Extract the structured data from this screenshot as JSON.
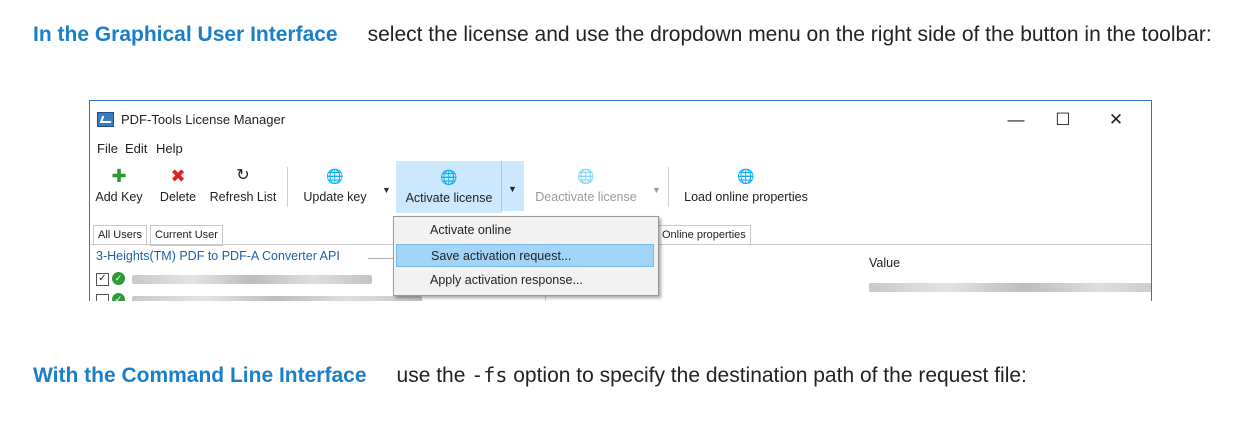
{
  "intro": {
    "keyword": "In the Graphical User Interface",
    "text": "select the license and use the dropdown menu on the right side of the button in the toolbar:"
  },
  "window": {
    "title": "PDF-Tools License Manager",
    "controls": {
      "minimize": "—",
      "maximize": "☐",
      "close": "✕"
    },
    "menu": [
      "File",
      "Edit",
      "Help"
    ],
    "toolbar": {
      "add_key": "Add Key",
      "delete": "Delete",
      "refresh": "Refresh List",
      "update_key": "Update key",
      "activate": "Activate license",
      "deactivate": "Deactivate license",
      "load_online": "Load online properties"
    },
    "tabs": [
      "All Users",
      "Current User",
      "Online properties"
    ],
    "tree_header": "3-Heights(TM) PDF to PDF-A Converter API",
    "value_header": "Value",
    "dropdown": [
      "Activate online",
      "Save activation request...",
      "Apply activation response..."
    ],
    "dropdown_highlighted": "Save activation request..."
  },
  "cli": {
    "keyword": "With the Command Line Interface",
    "text_before": "use the",
    "option": "-fs",
    "text_after": "option to specify the destination path of the request file:"
  },
  "colors": {
    "keyword": "#1a7fc8",
    "highlight": "#cce8ff",
    "menu_highlight": "#a2d4f7"
  }
}
